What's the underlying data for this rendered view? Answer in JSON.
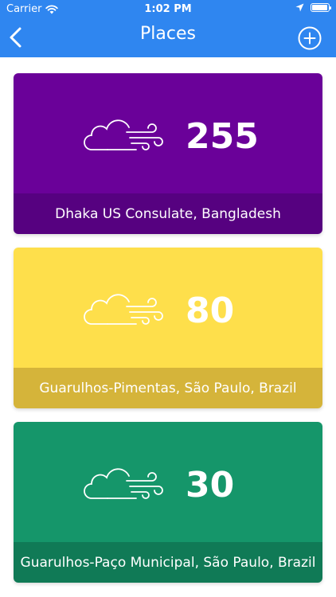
{
  "status": {
    "carrier": "Carrier",
    "time": "1:02 PM",
    "battery_level": 0.95
  },
  "nav": {
    "title": "Places",
    "back_icon": "chevron-left-icon",
    "add_icon": "plus-circle-icon"
  },
  "colors": {
    "header": "#2f86f0",
    "purple_top": "#6a0199",
    "purple_bottom": "#560180",
    "yellow_top": "#fedf4b",
    "yellow_bottom": "#d5b43a",
    "green_top": "#15966a",
    "green_bottom": "#107a56"
  },
  "places": [
    {
      "aqi": "255",
      "name": "Dhaka US Consulate, Bangladesh",
      "icon": "cloud-wind-icon"
    },
    {
      "aqi": "80",
      "name": "Guarulhos-Pimentas, São Paulo, Brazil",
      "icon": "cloud-wind-icon"
    },
    {
      "aqi": "30",
      "name": "Guarulhos-Paço Municipal, São Paulo, Brazil",
      "icon": "cloud-wind-icon"
    }
  ]
}
